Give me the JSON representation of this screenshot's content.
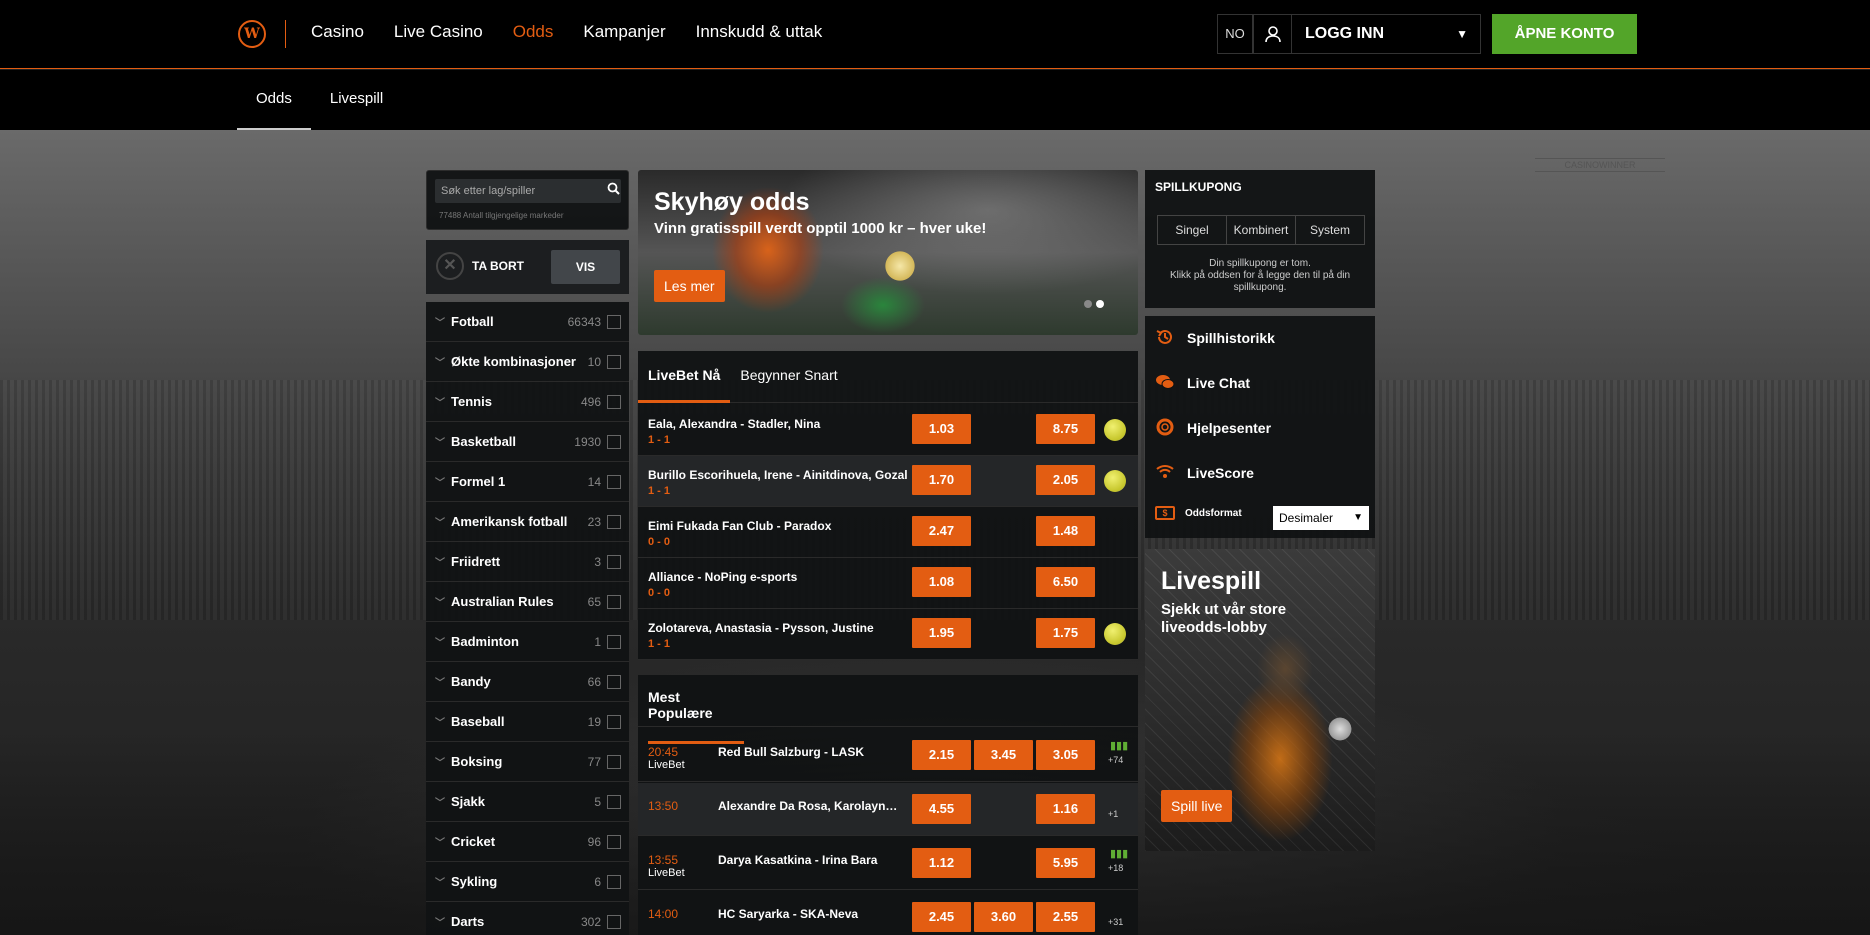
{
  "header": {
    "logo_letter": "W",
    "nav": [
      "Casino",
      "Live Casino",
      "Odds",
      "Kampanjer",
      "Innskudd & uttak"
    ],
    "nav_active": "Odds",
    "lang": "NO",
    "login_label": "LOGG INN",
    "open_account_label": "ÅPNE KONTO"
  },
  "subnav": {
    "items": [
      "Odds",
      "Livespill"
    ]
  },
  "search": {
    "placeholder": "Søk etter lag/spiller",
    "markets_count": "77488 Antall tilgjengelige markeder"
  },
  "filter": {
    "remove_label": "TA BORT",
    "show_label": "VIS"
  },
  "sports": [
    {
      "name": "Fotball",
      "count": "66343"
    },
    {
      "name": "Økte kombinasjoner",
      "count": "10"
    },
    {
      "name": "Tennis",
      "count": "496"
    },
    {
      "name": "Basketball",
      "count": "1930"
    },
    {
      "name": "Formel 1",
      "count": "14"
    },
    {
      "name": "Amerikansk fotball",
      "count": "23"
    },
    {
      "name": "Friidrett",
      "count": "3"
    },
    {
      "name": "Australian Rules",
      "count": "65"
    },
    {
      "name": "Badminton",
      "count": "1"
    },
    {
      "name": "Bandy",
      "count": "66"
    },
    {
      "name": "Baseball",
      "count": "19"
    },
    {
      "name": "Boksing",
      "count": "77"
    },
    {
      "name": "Sjakk",
      "count": "5"
    },
    {
      "name": "Cricket",
      "count": "96"
    },
    {
      "name": "Sykling",
      "count": "6"
    },
    {
      "name": "Darts",
      "count": "302"
    }
  ],
  "banner": {
    "title": "Skyhøy odds",
    "subtitle": "Vinn gratisspill verdt opptil 1000 kr – hver uke!",
    "button": "Les mer"
  },
  "live": {
    "tabs": [
      "LiveBet Nå",
      "Begynner Snart"
    ],
    "matches": [
      {
        "name": "Eala, Alexandra - Stadler, Nina",
        "score": "1 - 1",
        "odd1": "1.03",
        "odd2": "8.75",
        "ball": true
      },
      {
        "name": "Burillo Escorihuela, Irene - Ainitdinova, Gozal",
        "score": "1 - 1",
        "odd1": "1.70",
        "odd2": "2.05",
        "ball": true
      },
      {
        "name": "Eimi Fukada Fan Club - Paradox",
        "score": "0 - 0",
        "odd1": "2.47",
        "odd2": "1.48",
        "ball": false
      },
      {
        "name": "Alliance - NoPing e-sports",
        "score": "0 - 0",
        "odd1": "1.08",
        "odd2": "6.50",
        "ball": false
      },
      {
        "name": "Zolotareva, Anastasia - Pysson, Justine",
        "score": "1 - 1",
        "odd1": "1.95",
        "odd2": "1.75",
        "ball": true
      }
    ]
  },
  "popular": {
    "title": "Mest Populære",
    "matches": [
      {
        "time": "20:45",
        "live": "LiveBet",
        "name": "Red Bull Salzburg - LASK",
        "odds": [
          "2.15",
          "3.45",
          "3.05"
        ],
        "more": "+74",
        "stats": true
      },
      {
        "time": "13:50",
        "live": "",
        "name": "Alexandre Da Rosa, Karolayne ...",
        "odds": [
          "4.55",
          "",
          "1.16"
        ],
        "more": "+1",
        "stats": false
      },
      {
        "time": "13:55",
        "live": "LiveBet",
        "name": "Darya Kasatkina - Irina Bara",
        "odds": [
          "1.12",
          "",
          "5.95"
        ],
        "more": "+18",
        "stats": true
      },
      {
        "time": "14:00",
        "live": "",
        "name": "HC Saryarka - SKA-Neva",
        "odds": [
          "2.45",
          "3.60",
          "2.55"
        ],
        "more": "+31",
        "stats": false
      }
    ]
  },
  "coupon": {
    "title": "SPILLKUPONG",
    "tabs": [
      "Singel",
      "Kombinert",
      "System"
    ],
    "empty_line1": "Din spillkupong er tom.",
    "empty_line2": "Klikk på oddsen for å legge den til på din spillkupong."
  },
  "links": {
    "items": [
      {
        "icon": "history-icon",
        "label": "Spillhistorikk"
      },
      {
        "icon": "chat-icon",
        "label": "Live Chat"
      },
      {
        "icon": "lifebuoy-icon",
        "label": "Hjelpesenter"
      },
      {
        "icon": "wifi-icon",
        "label": "LiveScore"
      }
    ],
    "odds_format_label": "Oddsformat",
    "odds_format_value": "Desimaler"
  },
  "promo": {
    "title": "Livespill",
    "subtitle": "Sjekk ut vår store liveodds-lobby",
    "button": "Spill live"
  },
  "watermark": "CASINOWINNER",
  "colors": {
    "accent": "#e35d12",
    "green": "#53a529"
  }
}
